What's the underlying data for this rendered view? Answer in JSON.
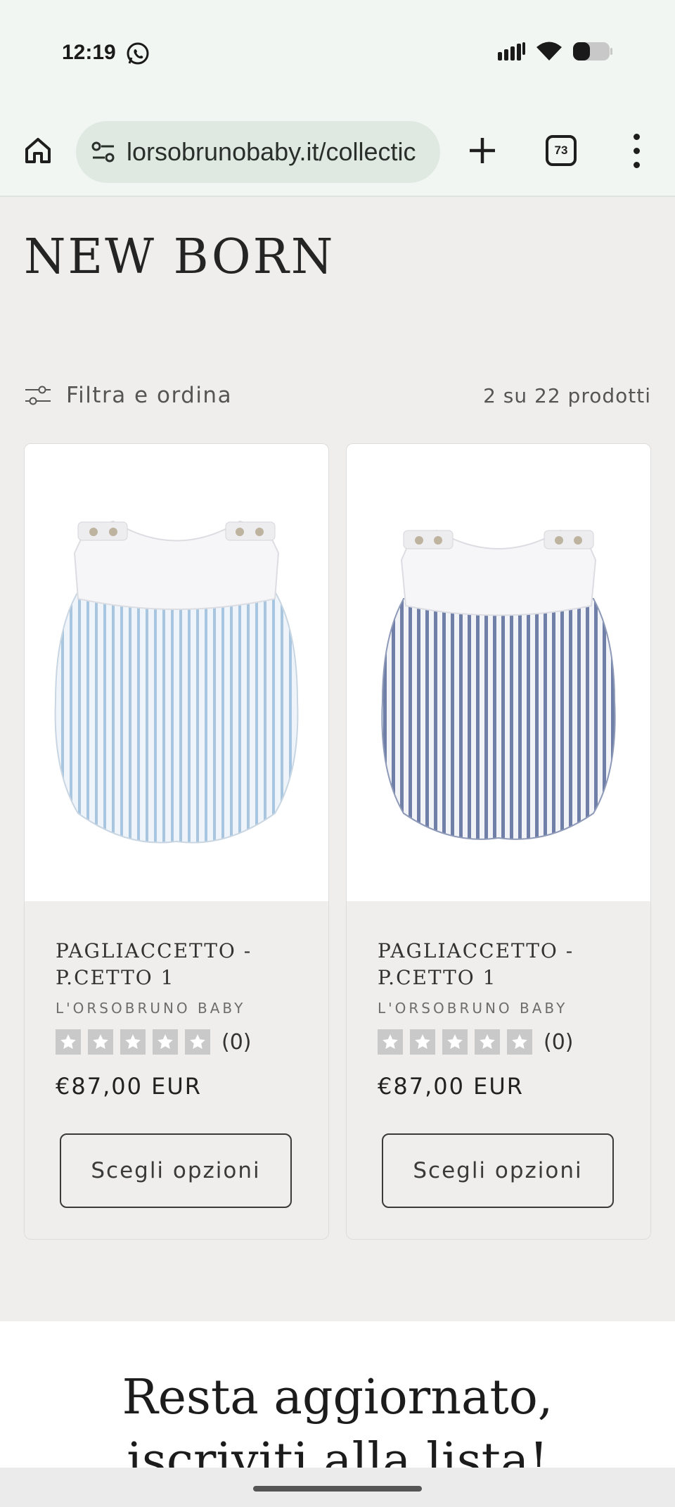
{
  "status_bar": {
    "time": "12:19"
  },
  "browser": {
    "url": "lorsobrunobaby.it/collectic",
    "tab_count": "73"
  },
  "page": {
    "title": "NEW BORN",
    "filter_label": "Filtra e ordina",
    "product_count": "2 su 22 prodotti"
  },
  "products": [
    {
      "title_line1": "PAGLIACCETTO -",
      "title_line2": "P.CETTO 1",
      "vendor": "L'ORSOBRUNO BABY",
      "rating_count": "(0)",
      "price": "€87,00 EUR",
      "button": "Scegli opzioni",
      "stripe_color": "#a9c6e0"
    },
    {
      "title_line1": "PAGLIACCETTO -",
      "title_line2": "P.CETTO 1",
      "vendor": "L'ORSOBRUNO BABY",
      "rating_count": "(0)",
      "price": "€87,00 EUR",
      "button": "Scegli opzioni",
      "stripe_color": "#6f7fa8"
    }
  ],
  "newsletter": {
    "line1": "Resta aggiornato,",
    "line2": "iscriviti alla lista!"
  }
}
